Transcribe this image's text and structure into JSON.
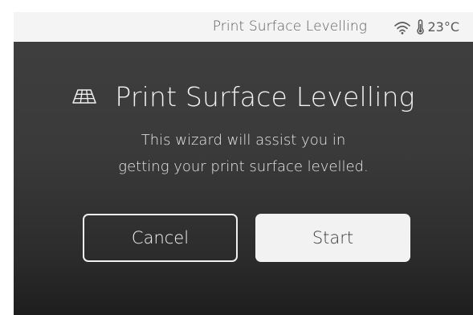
{
  "statusbar": {
    "title": "Print Surface Levelling",
    "temperature": "23°C",
    "icons": [
      "wifi-icon",
      "thermometer-icon"
    ]
  },
  "dialog": {
    "icon": "bed-grid-icon",
    "heading": "Print Surface Levelling",
    "description_lines": [
      "This wizard will assist you in",
      "getting your print surface levelled."
    ]
  },
  "buttons": {
    "cancel_label": "Cancel",
    "start_label": "Start"
  },
  "colors": {
    "background": "#3c3c3c",
    "statusbar": "#f4f4f4",
    "text_light": "#f2f2f2",
    "button_primary": "#f2f2f2"
  }
}
